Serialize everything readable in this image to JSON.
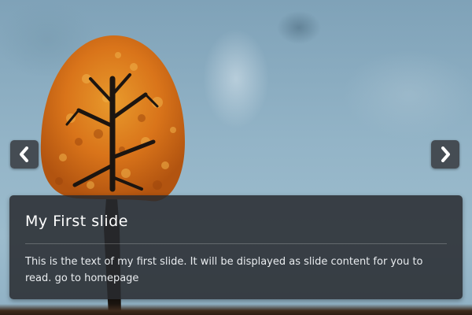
{
  "slide": {
    "title": "My First slide",
    "text": "This is the text of my first slide. It will be displayed as slide content for you to read.",
    "link_label": "go to homepage"
  },
  "controls": {
    "prev_icon": "chevron-left-icon",
    "next_icon": "chevron-right-icon"
  },
  "colors": {
    "sky": "#8fb0c4",
    "foliage": "#d9741a",
    "trunk": "#1c1510",
    "caption_bg": "#282a2e"
  }
}
